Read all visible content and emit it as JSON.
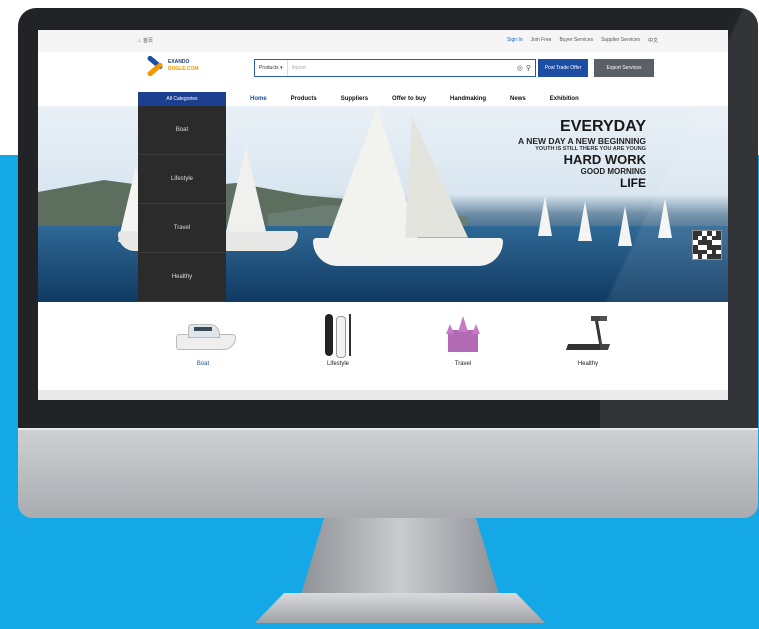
{
  "topbar": {
    "home_label": "首页",
    "sign_in": "Sign In",
    "join": "Join Free",
    "buyer_services": "Buyer Services",
    "supplier_services": "Supplier Services",
    "language": "中文"
  },
  "header": {
    "logo_title": "EXANDO",
    "logo_sub": "DUGLE.COM",
    "search_select": "Products",
    "search_placeholder": "Import",
    "post_button": "Post Trade Offer",
    "export_button": "Export Services"
  },
  "nav": {
    "all_categories": "All Categories",
    "items": [
      "Home",
      "Products",
      "Suppliers",
      "Offer to buy",
      "Handmaking",
      "News",
      "Exhibition"
    ]
  },
  "side_menu": [
    "Boat",
    "Lifestyle",
    "Travel",
    "Healthy"
  ],
  "hero": {
    "line1": "EVERYDAY",
    "line2": "A NEW DAY  A NEW BEGINNING",
    "line3": "YOUTH IS STILL THERE  YOU ARE YOUNG",
    "line4": "HARD WORK",
    "line5": "GOOD MORNING",
    "line6": "LIFE"
  },
  "products": [
    {
      "label": "Boat",
      "icon": "boat-icon"
    },
    {
      "label": "Lifestyle",
      "icon": "paddleboard-icon"
    },
    {
      "label": "Travel",
      "icon": "castle-icon"
    },
    {
      "label": "Healthy",
      "icon": "treadmill-icon"
    }
  ],
  "colors": {
    "background_blue": "#14a9e6",
    "brand_blue": "#1c4ea3",
    "monitor_bezel": "#222326"
  }
}
